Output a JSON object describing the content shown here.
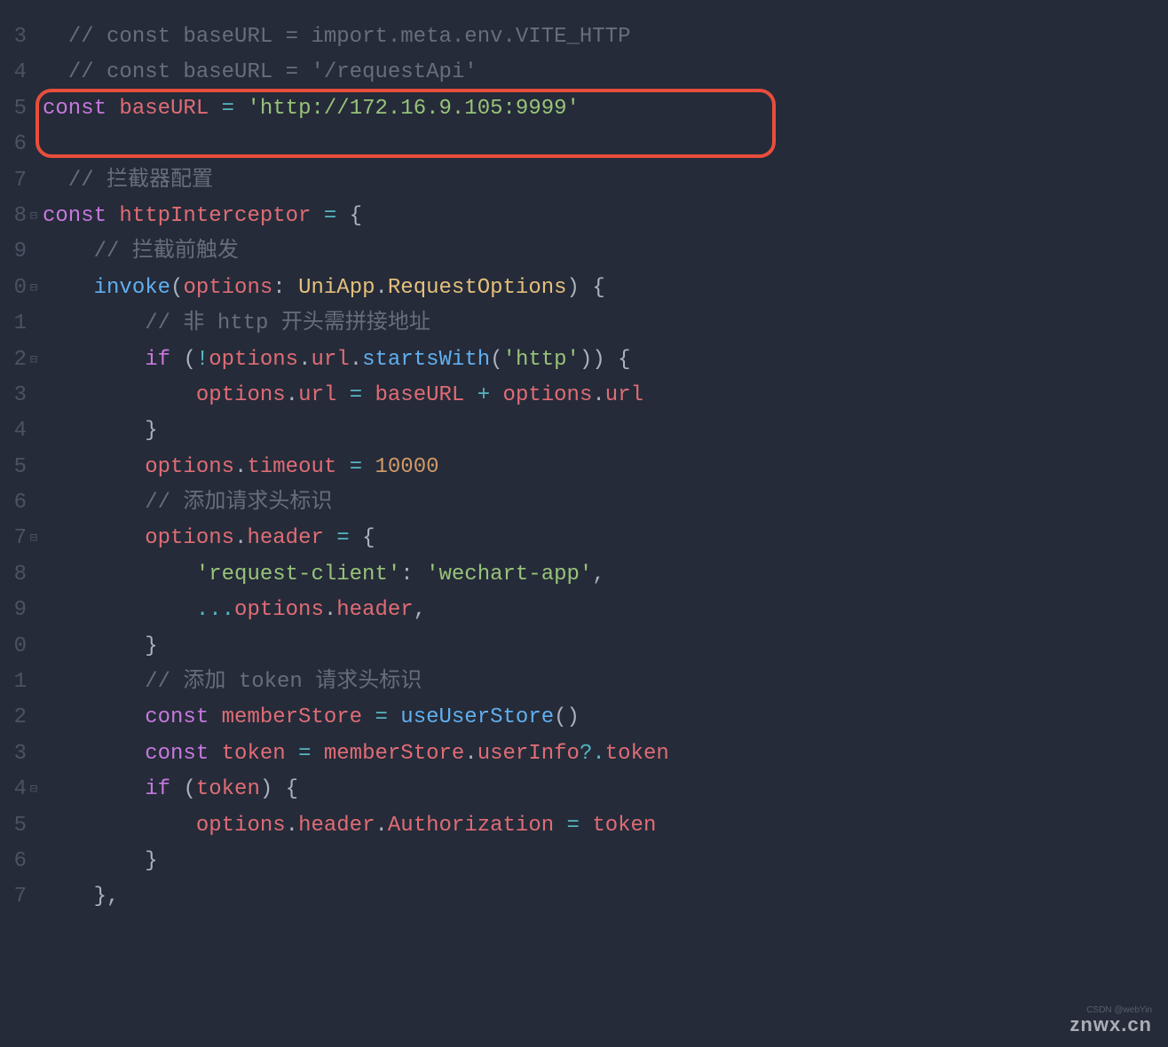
{
  "lineStart": 3,
  "lines": [
    {
      "n": "3",
      "fold": "",
      "tokens": [
        {
          "t": "  ",
          "c": ""
        },
        {
          "t": "// const baseURL = import.meta.env.VITE_HTTP",
          "c": "c-comment"
        }
      ]
    },
    {
      "n": "4",
      "fold": "",
      "tokens": [
        {
          "t": "  ",
          "c": ""
        },
        {
          "t": "// const baseURL = '/requestApi'",
          "c": "c-comment"
        }
      ]
    },
    {
      "n": "5",
      "fold": "",
      "tokens": [
        {
          "t": "const ",
          "c": "c-kw"
        },
        {
          "t": "baseURL",
          "c": "c-var"
        },
        {
          "t": " ",
          "c": ""
        },
        {
          "t": "=",
          "c": "c-op"
        },
        {
          "t": " ",
          "c": ""
        },
        {
          "t": "'http://172.16.9.105:9999'",
          "c": "c-str"
        }
      ]
    },
    {
      "n": "6",
      "fold": "",
      "tokens": [
        {
          "t": " ",
          "c": ""
        }
      ]
    },
    {
      "n": "7",
      "fold": "",
      "tokens": [
        {
          "t": "  ",
          "c": ""
        },
        {
          "t": "// 拦截器配置",
          "c": "c-comment"
        }
      ]
    },
    {
      "n": "8",
      "fold": "⊟",
      "tokens": [
        {
          "t": "const ",
          "c": "c-kw"
        },
        {
          "t": "httpInterceptor",
          "c": "c-var"
        },
        {
          "t": " ",
          "c": ""
        },
        {
          "t": "=",
          "c": "c-op"
        },
        {
          "t": " {",
          "c": "c-punc"
        }
      ]
    },
    {
      "n": "9",
      "fold": "",
      "tokens": [
        {
          "t": "    ",
          "c": ""
        },
        {
          "t": "// 拦截前触发",
          "c": "c-comment"
        }
      ]
    },
    {
      "n": "0",
      "fold": "⊟",
      "tokens": [
        {
          "t": "    ",
          "c": ""
        },
        {
          "t": "invoke",
          "c": "c-fn"
        },
        {
          "t": "(",
          "c": "c-punc"
        },
        {
          "t": "options",
          "c": "c-var"
        },
        {
          "t": ": ",
          "c": "c-punc"
        },
        {
          "t": "UniApp",
          "c": "c-type"
        },
        {
          "t": ".",
          "c": "c-punc"
        },
        {
          "t": "RequestOptions",
          "c": "c-type"
        },
        {
          "t": ") {",
          "c": "c-punc"
        }
      ]
    },
    {
      "n": "1",
      "fold": "",
      "tokens": [
        {
          "t": "        ",
          "c": ""
        },
        {
          "t": "// 非 http 开头需拼接地址",
          "c": "c-comment"
        }
      ]
    },
    {
      "n": "2",
      "fold": "⊟",
      "tokens": [
        {
          "t": "        ",
          "c": ""
        },
        {
          "t": "if ",
          "c": "c-kw"
        },
        {
          "t": "(",
          "c": "c-punc"
        },
        {
          "t": "!",
          "c": "c-op"
        },
        {
          "t": "options",
          "c": "c-var"
        },
        {
          "t": ".",
          "c": "c-punc"
        },
        {
          "t": "url",
          "c": "c-prop"
        },
        {
          "t": ".",
          "c": "c-punc"
        },
        {
          "t": "startsWith",
          "c": "c-fn"
        },
        {
          "t": "(",
          "c": "c-punc"
        },
        {
          "t": "'http'",
          "c": "c-str"
        },
        {
          "t": ")) {",
          "c": "c-punc"
        }
      ]
    },
    {
      "n": "3",
      "fold": "",
      "tokens": [
        {
          "t": "            ",
          "c": ""
        },
        {
          "t": "options",
          "c": "c-var"
        },
        {
          "t": ".",
          "c": "c-punc"
        },
        {
          "t": "url",
          "c": "c-prop"
        },
        {
          "t": " ",
          "c": ""
        },
        {
          "t": "=",
          "c": "c-op"
        },
        {
          "t": " ",
          "c": ""
        },
        {
          "t": "baseURL",
          "c": "c-var"
        },
        {
          "t": " ",
          "c": ""
        },
        {
          "t": "+",
          "c": "c-op"
        },
        {
          "t": " ",
          "c": ""
        },
        {
          "t": "options",
          "c": "c-var"
        },
        {
          "t": ".",
          "c": "c-punc"
        },
        {
          "t": "url",
          "c": "c-prop"
        }
      ]
    },
    {
      "n": "4",
      "fold": "",
      "tokens": [
        {
          "t": "        }",
          "c": "c-punc"
        }
      ]
    },
    {
      "n": "5",
      "fold": "",
      "tokens": [
        {
          "t": "        ",
          "c": ""
        },
        {
          "t": "options",
          "c": "c-var"
        },
        {
          "t": ".",
          "c": "c-punc"
        },
        {
          "t": "timeout",
          "c": "c-prop"
        },
        {
          "t": " ",
          "c": ""
        },
        {
          "t": "=",
          "c": "c-op"
        },
        {
          "t": " ",
          "c": ""
        },
        {
          "t": "10000",
          "c": "c-num"
        }
      ]
    },
    {
      "n": "6",
      "fold": "",
      "tokens": [
        {
          "t": "        ",
          "c": ""
        },
        {
          "t": "// 添加请求头标识",
          "c": "c-comment"
        }
      ]
    },
    {
      "n": "7",
      "fold": "⊟",
      "tokens": [
        {
          "t": "        ",
          "c": ""
        },
        {
          "t": "options",
          "c": "c-var"
        },
        {
          "t": ".",
          "c": "c-punc"
        },
        {
          "t": "header",
          "c": "c-prop"
        },
        {
          "t": " ",
          "c": ""
        },
        {
          "t": "=",
          "c": "c-op"
        },
        {
          "t": " {",
          "c": "c-punc"
        }
      ]
    },
    {
      "n": "8",
      "fold": "",
      "tokens": [
        {
          "t": "            ",
          "c": ""
        },
        {
          "t": "'request-client'",
          "c": "c-str"
        },
        {
          "t": ": ",
          "c": "c-punc"
        },
        {
          "t": "'wechart-app'",
          "c": "c-str"
        },
        {
          "t": ",",
          "c": "c-punc"
        }
      ]
    },
    {
      "n": "9",
      "fold": "",
      "tokens": [
        {
          "t": "            ",
          "c": ""
        },
        {
          "t": "...",
          "c": "c-op"
        },
        {
          "t": "options",
          "c": "c-var"
        },
        {
          "t": ".",
          "c": "c-punc"
        },
        {
          "t": "header",
          "c": "c-prop"
        },
        {
          "t": ",",
          "c": "c-punc"
        }
      ]
    },
    {
      "n": "0",
      "fold": "",
      "tokens": [
        {
          "t": "        }",
          "c": "c-punc"
        }
      ]
    },
    {
      "n": "1",
      "fold": "",
      "tokens": [
        {
          "t": "        ",
          "c": ""
        },
        {
          "t": "// 添加 token 请求头标识",
          "c": "c-comment"
        }
      ]
    },
    {
      "n": "2",
      "fold": "",
      "tokens": [
        {
          "t": "        ",
          "c": ""
        },
        {
          "t": "const ",
          "c": "c-kw"
        },
        {
          "t": "memberStore",
          "c": "c-var"
        },
        {
          "t": " ",
          "c": ""
        },
        {
          "t": "=",
          "c": "c-op"
        },
        {
          "t": " ",
          "c": ""
        },
        {
          "t": "useUserStore",
          "c": "c-fn"
        },
        {
          "t": "()",
          "c": "c-punc"
        }
      ]
    },
    {
      "n": "3",
      "fold": "",
      "tokens": [
        {
          "t": "        ",
          "c": ""
        },
        {
          "t": "const ",
          "c": "c-kw"
        },
        {
          "t": "token",
          "c": "c-var"
        },
        {
          "t": " ",
          "c": ""
        },
        {
          "t": "=",
          "c": "c-op"
        },
        {
          "t": " ",
          "c": ""
        },
        {
          "t": "memberStore",
          "c": "c-var"
        },
        {
          "t": ".",
          "c": "c-punc"
        },
        {
          "t": "userInfo",
          "c": "c-prop"
        },
        {
          "t": "?.",
          "c": "c-op"
        },
        {
          "t": "token",
          "c": "c-prop"
        }
      ]
    },
    {
      "n": "4",
      "fold": "⊟",
      "tokens": [
        {
          "t": "        ",
          "c": ""
        },
        {
          "t": "if ",
          "c": "c-kw"
        },
        {
          "t": "(",
          "c": "c-punc"
        },
        {
          "t": "token",
          "c": "c-var"
        },
        {
          "t": ") {",
          "c": "c-punc"
        }
      ]
    },
    {
      "n": "5",
      "fold": "",
      "tokens": [
        {
          "t": "            ",
          "c": ""
        },
        {
          "t": "options",
          "c": "c-var"
        },
        {
          "t": ".",
          "c": "c-punc"
        },
        {
          "t": "header",
          "c": "c-prop"
        },
        {
          "t": ".",
          "c": "c-punc"
        },
        {
          "t": "Authorization",
          "c": "c-prop"
        },
        {
          "t": " ",
          "c": ""
        },
        {
          "t": "=",
          "c": "c-op"
        },
        {
          "t": " ",
          "c": ""
        },
        {
          "t": "token",
          "c": "c-var"
        }
      ]
    },
    {
      "n": "6",
      "fold": "",
      "tokens": [
        {
          "t": "        }",
          "c": "c-punc"
        }
      ]
    },
    {
      "n": "7",
      "fold": "",
      "tokens": [
        {
          "t": "    },",
          "c": "c-punc"
        }
      ]
    }
  ],
  "watermark": "znwx.cn",
  "watermarkSub": "CSDN @webYin"
}
